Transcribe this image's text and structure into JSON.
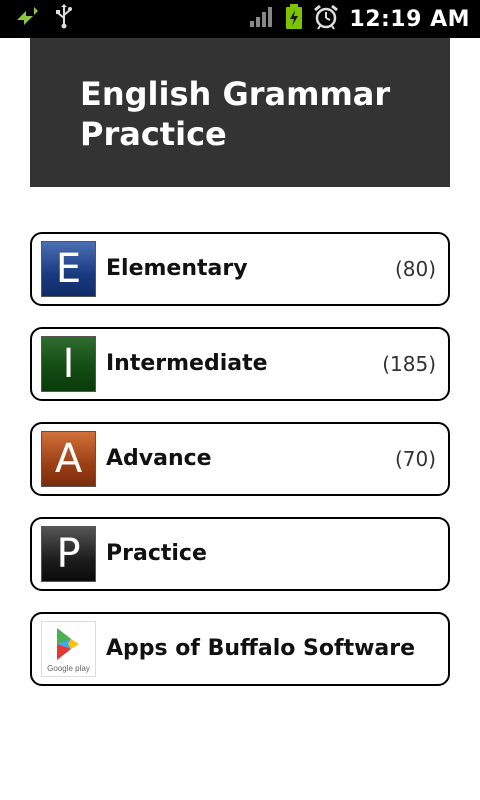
{
  "status_bar": {
    "time": "12:19 AM",
    "icons": [
      "sync-icon",
      "usb-icon",
      "signal-icon",
      "battery-charging-icon",
      "alarm-icon"
    ]
  },
  "header": {
    "title_line1": "English Grammar",
    "title_line2": "Practice"
  },
  "menu": {
    "items": [
      {
        "icon_letter": "E",
        "label": "Elementary",
        "count": "(80)"
      },
      {
        "icon_letter": "I",
        "label": "Intermediate",
        "count": "(185)"
      },
      {
        "icon_letter": "A",
        "label": "Advance",
        "count": "(70)"
      },
      {
        "icon_letter": "P",
        "label": "Practice",
        "count": ""
      },
      {
        "icon_letter": "",
        "label": "Apps of Buffalo Software",
        "count": "",
        "icon_caption": "Google play"
      }
    ]
  },
  "colors": {
    "header_bg": "#333333",
    "status_bg": "#000000",
    "battery_green": "#7cc400"
  }
}
